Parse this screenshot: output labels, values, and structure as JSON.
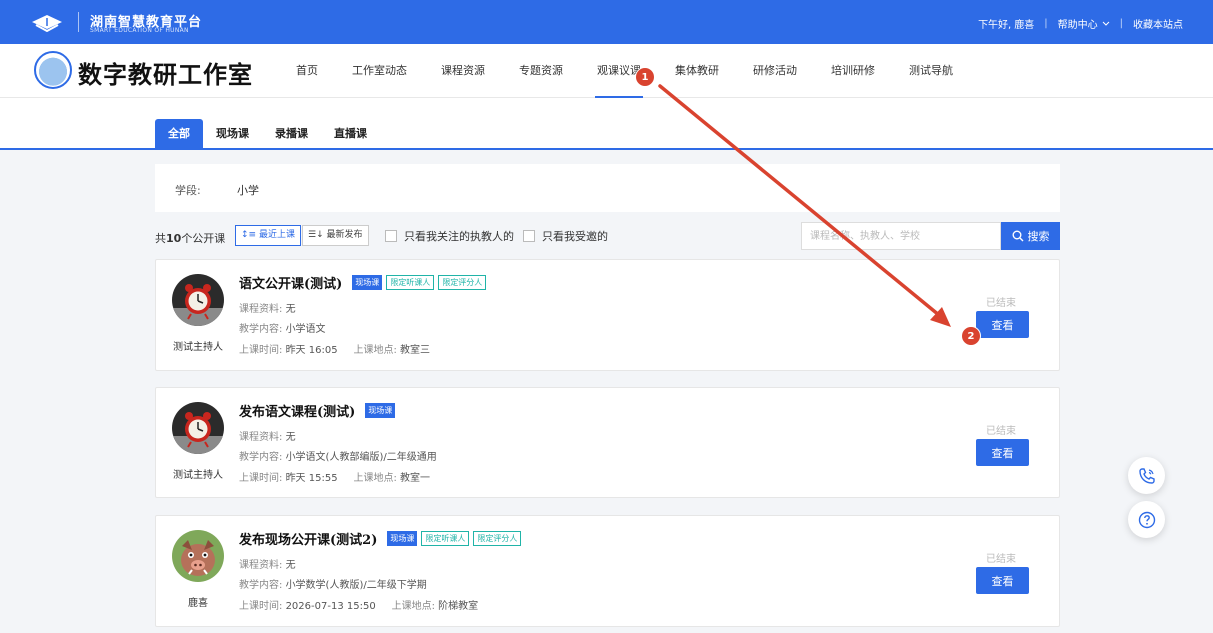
{
  "topbar": {
    "brand_cn": "湖南智慧教育平台",
    "brand_en": "SMART EDUCATION OF HUNAN",
    "greeting": "下午好,",
    "user": "鹿喜",
    "help": "帮助中心",
    "bookmark": "收藏本站点",
    "color": "#2e6be6"
  },
  "header": {
    "title": "数字教研工作室",
    "nav": [
      "首页",
      "工作室动态",
      "课程资源",
      "专题资源",
      "观课议课",
      "集体教研",
      "研修活动",
      "培训研修",
      "测试导航"
    ],
    "active_nav": "观课议课"
  },
  "tabs": [
    "全部",
    "现场课",
    "录播课",
    "直播课"
  ],
  "filter": {
    "label": "学段:",
    "value": "小学"
  },
  "toolbar": {
    "count_prefix": "共",
    "count": "10",
    "count_suffix": "个公开课",
    "sort_recent": "最近上课",
    "sort_new": "最新发布",
    "check_follow": "只看我关注的执教人的",
    "check_invited": "只看我受邀的",
    "search_placeholder": "课程名称、执教人、学校",
    "search_button": "搜索"
  },
  "labels": {
    "material": "课程资料:",
    "content": "教学内容:",
    "time": "上课时间:",
    "place": "上课地点:",
    "view": "查看"
  },
  "courses": [
    {
      "title": "语文公开课(测试)",
      "type": "现场课",
      "tags": [
        "限定听课人",
        "限定评分人"
      ],
      "material": "无",
      "content": "小学语文",
      "time": "昨天 16:05",
      "place": "教室三",
      "host": "测试主持人",
      "status": "已结束",
      "avatar": "alarm-clock"
    },
    {
      "title": "发布语文课程(测试)",
      "type": "现场课",
      "tags": [],
      "material": "无",
      "content": "小学语文(人教部编版)/二年级通用",
      "time": "昨天 15:55",
      "place": "教室一",
      "host": "测试主持人",
      "status": "已结束",
      "avatar": "alarm-clock"
    },
    {
      "title": "发布现场公开课(测试2)",
      "type": "现场课",
      "tags": [
        "限定听课人",
        "限定评分人"
      ],
      "material": "无",
      "content": "小学数学(人教版)/二年级下学期",
      "time": "2026-07-13 15:50",
      "place": "阶梯教室",
      "host": "鹿喜",
      "status": "已结束",
      "avatar": "cartoon-pig"
    }
  ],
  "annotations": {
    "marker1": "1",
    "marker2": "2",
    "arrow_color": "#d9432f"
  }
}
